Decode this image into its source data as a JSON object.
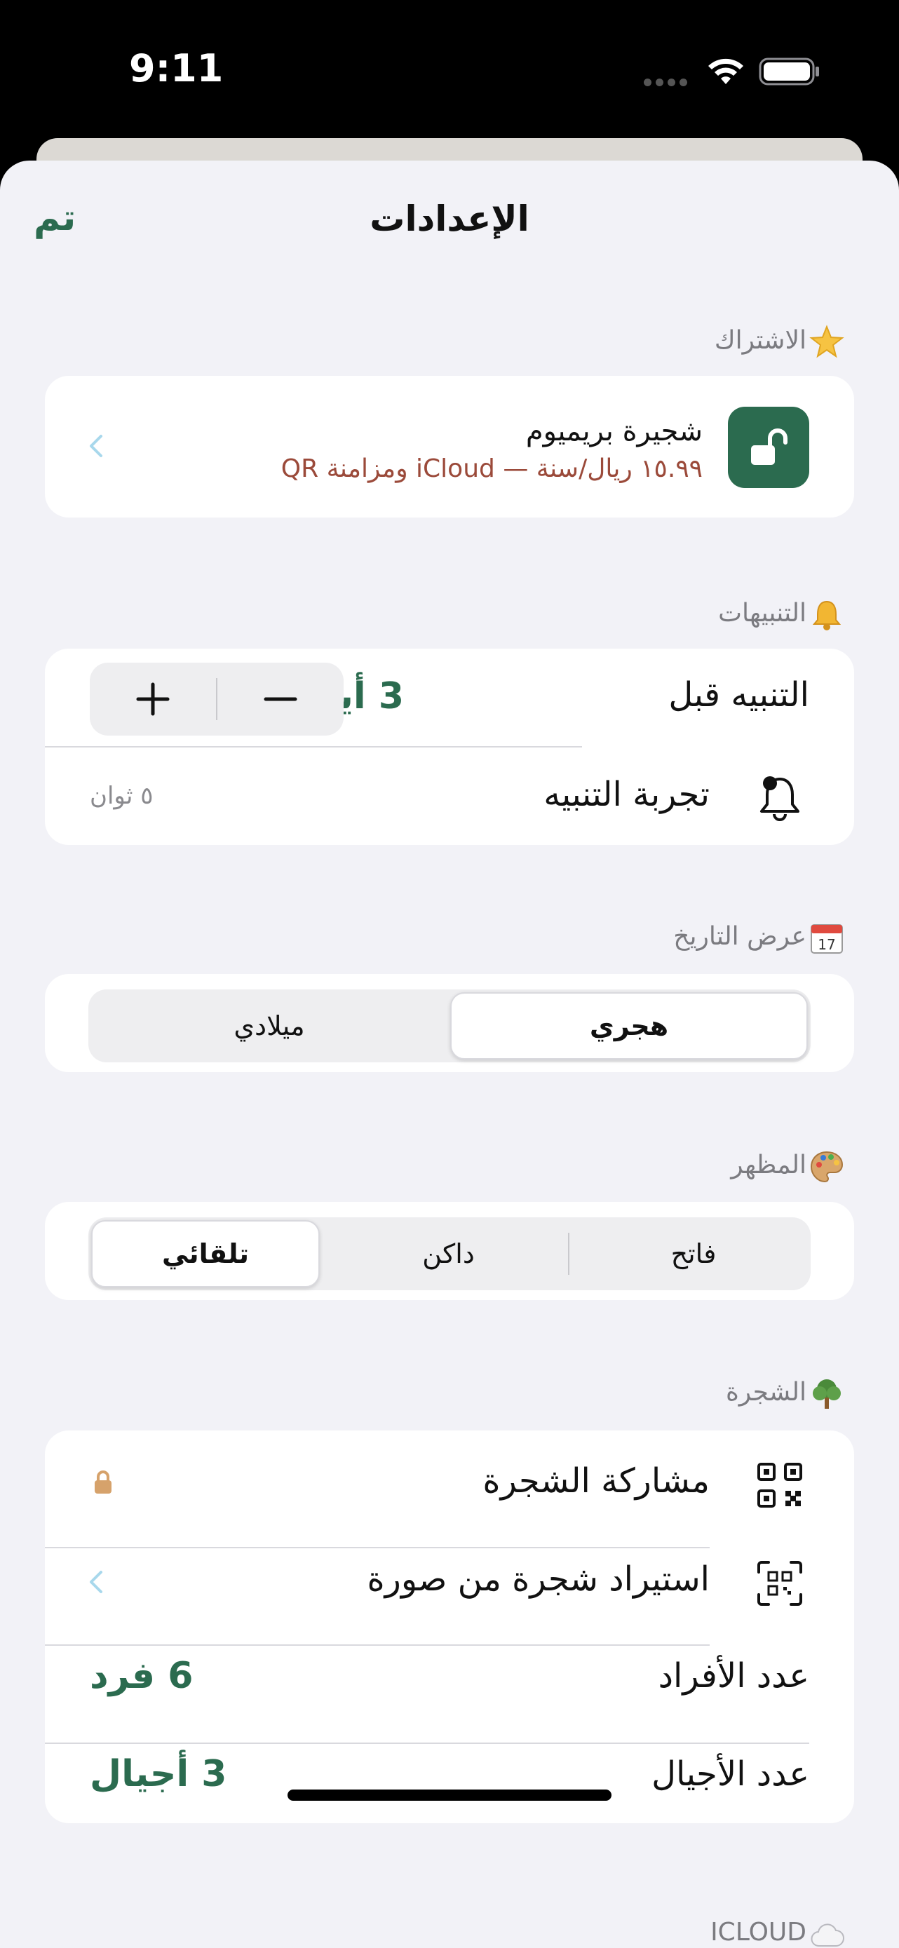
{
  "status": {
    "time": "9:11"
  },
  "nav": {
    "title": "الإعدادات",
    "done": "تم"
  },
  "subscription": {
    "header": "الاشتراك",
    "title": "شجيرة بريميوم",
    "description": "١٥.٩٩ ريال/سنة — iCloud ومزامنة QR"
  },
  "alerts": {
    "header": "التنبيهات",
    "alert_before_label": "التنبيه قبل",
    "alert_before_value": "3 أيام",
    "test_label": "تجربة التنبيه",
    "test_hint": "٥ ثوان"
  },
  "date_display": {
    "header": "عرض التاريخ",
    "options": [
      "هجري",
      "ميلادي"
    ],
    "selected": "هجري"
  },
  "appearance": {
    "header": "المظهر",
    "options": [
      "فاتح",
      "داكن",
      "تلقائي"
    ],
    "selected": "تلقائي"
  },
  "tree": {
    "header": "الشجرة",
    "share_label": "مشاركة الشجرة",
    "import_label": "استيراد شجرة من صورة",
    "members_label": "عدد الأفراد",
    "members_value": "6 فرد",
    "generations_label": "عدد الأجيال",
    "generations_value": "3 أجيال"
  },
  "icloud": {
    "header": "ICLOUD"
  },
  "colors": {
    "accent": "#2b6b4f",
    "subtitle": "#9b4a3a",
    "background": "#f2f2f7"
  }
}
